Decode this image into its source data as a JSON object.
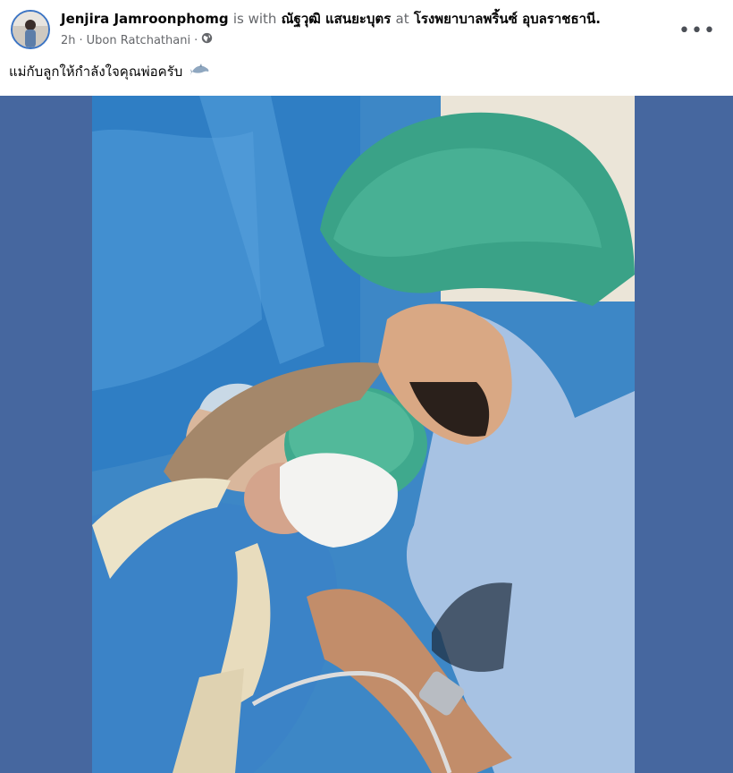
{
  "post": {
    "author": "Jenjira Jamroonphomg",
    "is_with_text": "is with",
    "tagged_person": "ณัฐวุฒิ แสนยะบุตร",
    "at_text": "at",
    "location": "โรงพยาบาลพริ้นซ์ อุบลราชธานี.",
    "time": "2h",
    "separator": "·",
    "place": "Ubon Ratchathani",
    "audience_icon": "globe-icon",
    "more_icon": "more-options-icon",
    "more_label": "•••",
    "caption": "แม่กับลูกให้กำลังใจคุณพ่อครับ",
    "caption_emoji_icon": "dolphin-icon"
  },
  "colors": {
    "photo_frame": "#46679f",
    "avatar_ring": "#3b74c4",
    "secondary_text": "#65676b"
  }
}
